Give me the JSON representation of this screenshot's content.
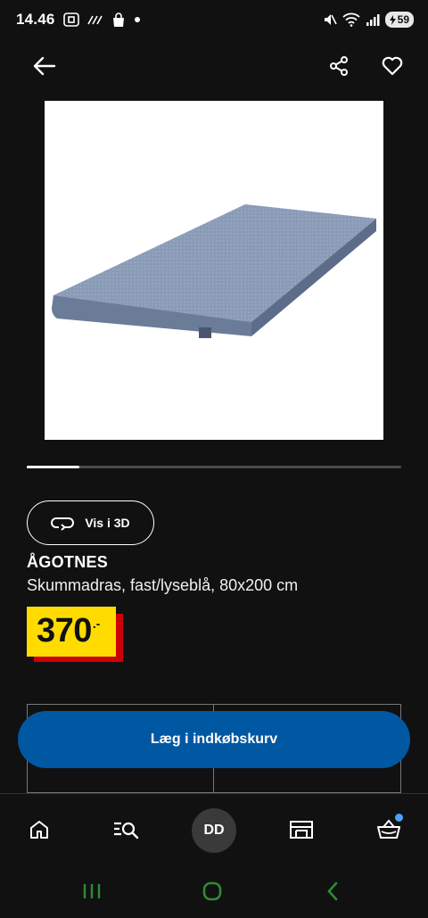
{
  "status_bar": {
    "time": "14.46",
    "battery": "59"
  },
  "product": {
    "name": "ÅGOTNES",
    "description": "Skummadras, fast/lyseblå, 80x200 cm",
    "price": "370",
    "price_suffix": ".-",
    "view_3d_label": "Vis i 3D",
    "carousel_progress": 0.14
  },
  "actions": {
    "add_to_cart_label": "Læg i indkøbskurv"
  },
  "bottom_nav": {
    "items": [
      "home-icon",
      "search-list-icon",
      "avatar",
      "store-icon",
      "basket-icon"
    ],
    "avatar_initials": "DD"
  },
  "colors": {
    "background": "#111111",
    "primary_button": "#0058a3",
    "price_yellow": "#ffdb00",
    "price_red": "#cc0008",
    "notification_dot": "#4aa3ff",
    "system_nav_green": "#2f8a36"
  }
}
